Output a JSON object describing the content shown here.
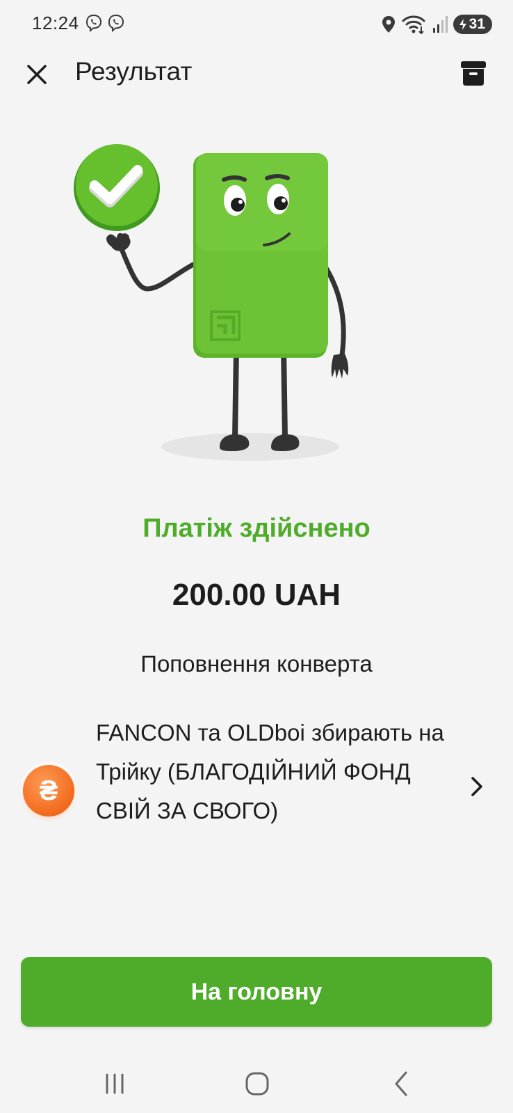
{
  "status_bar": {
    "time": "12:24",
    "battery_level": "31",
    "icons": [
      "viber-icon",
      "viber-icon",
      "location-icon",
      "wifi-icon",
      "signal-icon",
      "battery-icon"
    ]
  },
  "header": {
    "title": "Результат",
    "close_icon": "close-icon",
    "archive_icon": "archive-icon"
  },
  "result": {
    "status": "Платіж здійснено",
    "amount": "200.00 UAH",
    "operation": "Поповнення конверта"
  },
  "recipient": {
    "name": "FANCON та OLDboi збирають на Трійку (БЛАГОДІЙНИЙ ФОНД СВІЙ ЗА СВОГО)",
    "avatar_symbol": "₴",
    "avatar_color": "#f26a1c"
  },
  "actions": {
    "home_label": "На головну"
  },
  "colors": {
    "accent": "#4eac2a",
    "background": "#f4f4f4"
  },
  "nav": {
    "icons": [
      "recent-apps-icon",
      "home-icon",
      "back-icon"
    ]
  }
}
